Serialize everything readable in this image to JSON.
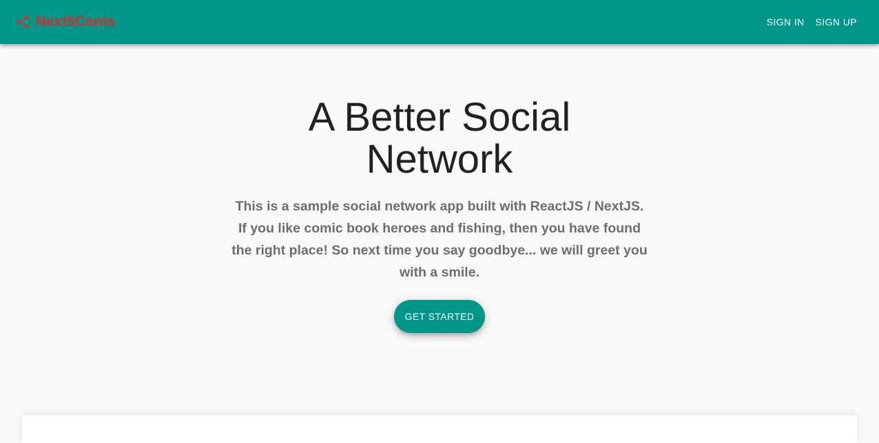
{
  "header": {
    "brand": "Next5Cents",
    "brand_icon": "share-icon",
    "brand_color": "#d32f2f",
    "bar_color": "#009688",
    "nav": {
      "sign_in": "SIGN IN",
      "sign_up": "SIGN UP"
    }
  },
  "hero": {
    "title": "A Better Social Network",
    "description": "This is a sample social network app built with ReactJS / NextJS. If you like comic book heroes and fishing, then you have found the right place! So next time you say goodbye... we will greet you with a smile.",
    "cta_label": "GET STARTED"
  }
}
